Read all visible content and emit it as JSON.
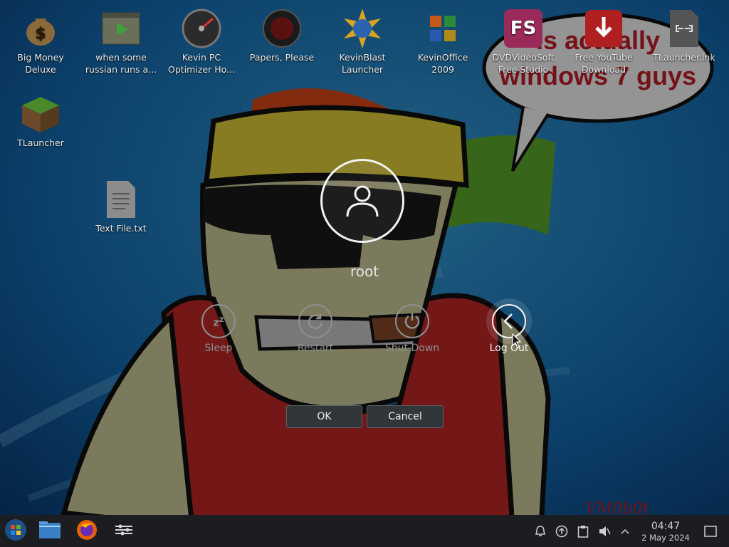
{
  "desktop": {
    "icons": [
      {
        "label": "Big Money Deluxe",
        "icon": "money-bag-icon"
      },
      {
        "label": "when some russian runs a...",
        "icon": "video-file-icon"
      },
      {
        "label": "Kevin PC Optimizer Ho...",
        "icon": "speedometer-icon"
      },
      {
        "label": "Papers, Please",
        "icon": "game-seal-icon"
      },
      {
        "label": "KevinBlast Launcher",
        "icon": "globe-burst-icon"
      },
      {
        "label": "KevinOffice 2009",
        "icon": "office-icon"
      },
      {
        "label": "DVDVideoSoft Free Studio",
        "icon": "fs-icon"
      },
      {
        "label": "Free YouTube Download",
        "icon": "download-arrow-icon"
      },
      {
        "label": "TLauncher.lnk",
        "icon": "link-file-icon"
      },
      {
        "label": "TLauncher",
        "icon": "grass-block-icon"
      },
      {
        "label": "Text File.txt",
        "icon": "text-file-icon"
      }
    ],
    "wallpaper_text": "is actually windows 7 guys",
    "wallpaper_signature": "VM0b0t"
  },
  "dialog": {
    "username": "root",
    "actions": [
      {
        "label": "Sleep",
        "icon": "sleep-icon",
        "active": false
      },
      {
        "label": "Restart",
        "icon": "restart-icon",
        "active": false
      },
      {
        "label": "Shut Down",
        "icon": "power-icon",
        "active": false
      },
      {
        "label": "Log Out",
        "icon": "logout-chevron-icon",
        "active": true
      }
    ],
    "ok_label": "OK",
    "cancel_label": "Cancel"
  },
  "taskbar": {
    "launchers": [
      "start-menu-icon",
      "file-manager-icon",
      "firefox-icon",
      "system-settings-icon"
    ],
    "tray": [
      "notifications-icon",
      "updates-icon",
      "clipboard-icon",
      "volume-muted-icon",
      "expand-tray-icon"
    ],
    "time": "04:47",
    "date": "2 May 2024"
  },
  "colors": {
    "accent_red": "#c62828",
    "dialog_button_bg": "#31363b",
    "taskbar_bg": "#1b1d20"
  }
}
